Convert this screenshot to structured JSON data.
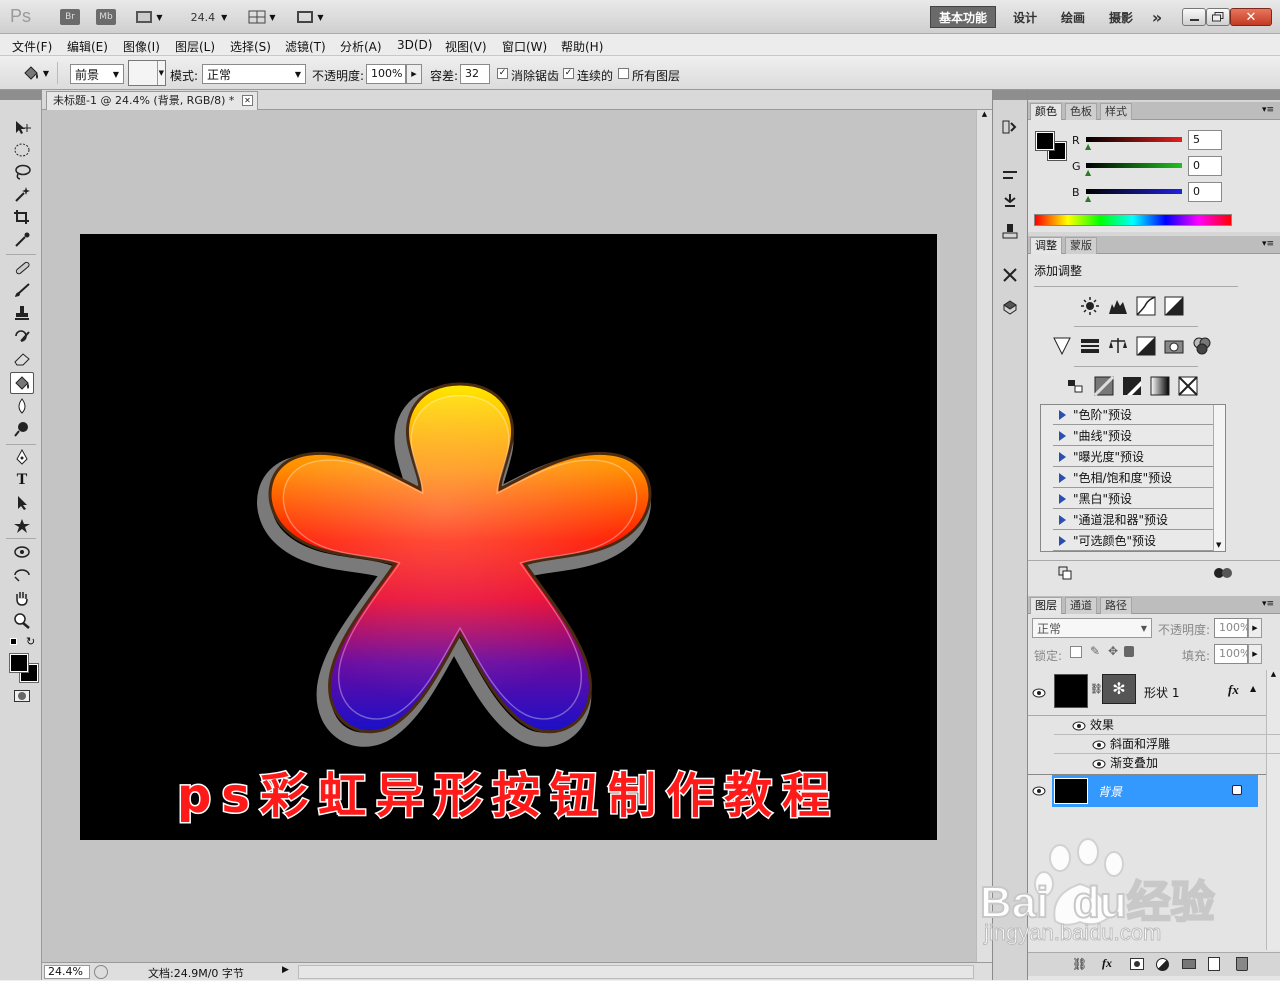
{
  "app": {
    "logo": "Ps",
    "br": "Br",
    "mb": "Mb",
    "zoom": "24.4"
  },
  "workspaces": [
    "基本功能",
    "设计",
    "绘画",
    "摄影"
  ],
  "workspace_more": "»",
  "menu": [
    "文件(F)",
    "编辑(E)",
    "图像(I)",
    "图层(L)",
    "选择(S)",
    "滤镜(T)",
    "分析(A)",
    "3D(D)",
    "视图(V)",
    "窗口(W)",
    "帮助(H)"
  ],
  "options": {
    "fill_source": "前景",
    "mode_label": "模式:",
    "mode_value": "正常",
    "opacity_label": "不透明度:",
    "opacity_value": "100%",
    "tolerance_label": "容差:",
    "tolerance_value": "32",
    "antialias_label": "消除锯齿",
    "contiguous_label": "连续的",
    "alllayers_label": "所有图层"
  },
  "document": {
    "tab_title": "未标题-1 @ 24.4% (背景, RGB/8) *",
    "caption": "ps彩虹异形按钮制作教程"
  },
  "status": {
    "zoom": "24.4%",
    "doc": "文档:24.9M/0 字节"
  },
  "color_panel": {
    "tabs": [
      "颜色",
      "色板",
      "样式"
    ],
    "channels": [
      {
        "label": "R",
        "value": "5",
        "color": "#e02020"
      },
      {
        "label": "G",
        "value": "0",
        "color": "#20c020"
      },
      {
        "label": "B",
        "value": "0",
        "color": "#2020e0"
      }
    ]
  },
  "adjust_panel": {
    "tabs": [
      "调整",
      "蒙版"
    ],
    "title": "添加调整",
    "presets": [
      "\"色阶\"预设",
      "\"曲线\"预设",
      "\"曝光度\"预设",
      "\"色相/饱和度\"预设",
      "\"黑白\"预设",
      "\"通道混和器\"预设",
      "\"可选颜色\"预设"
    ]
  },
  "layers_panel": {
    "tabs": [
      "图层",
      "通道",
      "路径"
    ],
    "blend": "正常",
    "opacity_label": "不透明度:",
    "opacity_value": "100%",
    "lock_label": "锁定:",
    "fill_label": "填充:",
    "fill_value": "100%",
    "layer1_name": "形状 1",
    "fx_label": "fx",
    "effects_label": "效果",
    "effect1": "斜面和浮雕",
    "effect2": "渐变叠加",
    "bg_name": "背景"
  },
  "watermark": {
    "brand": "Bai  du经验",
    "url": "jingyan.baidu.com"
  },
  "colors": {
    "accent": "#3399ff",
    "canvas_bg": "#000000",
    "caption_fill": "#ff1a1a"
  }
}
